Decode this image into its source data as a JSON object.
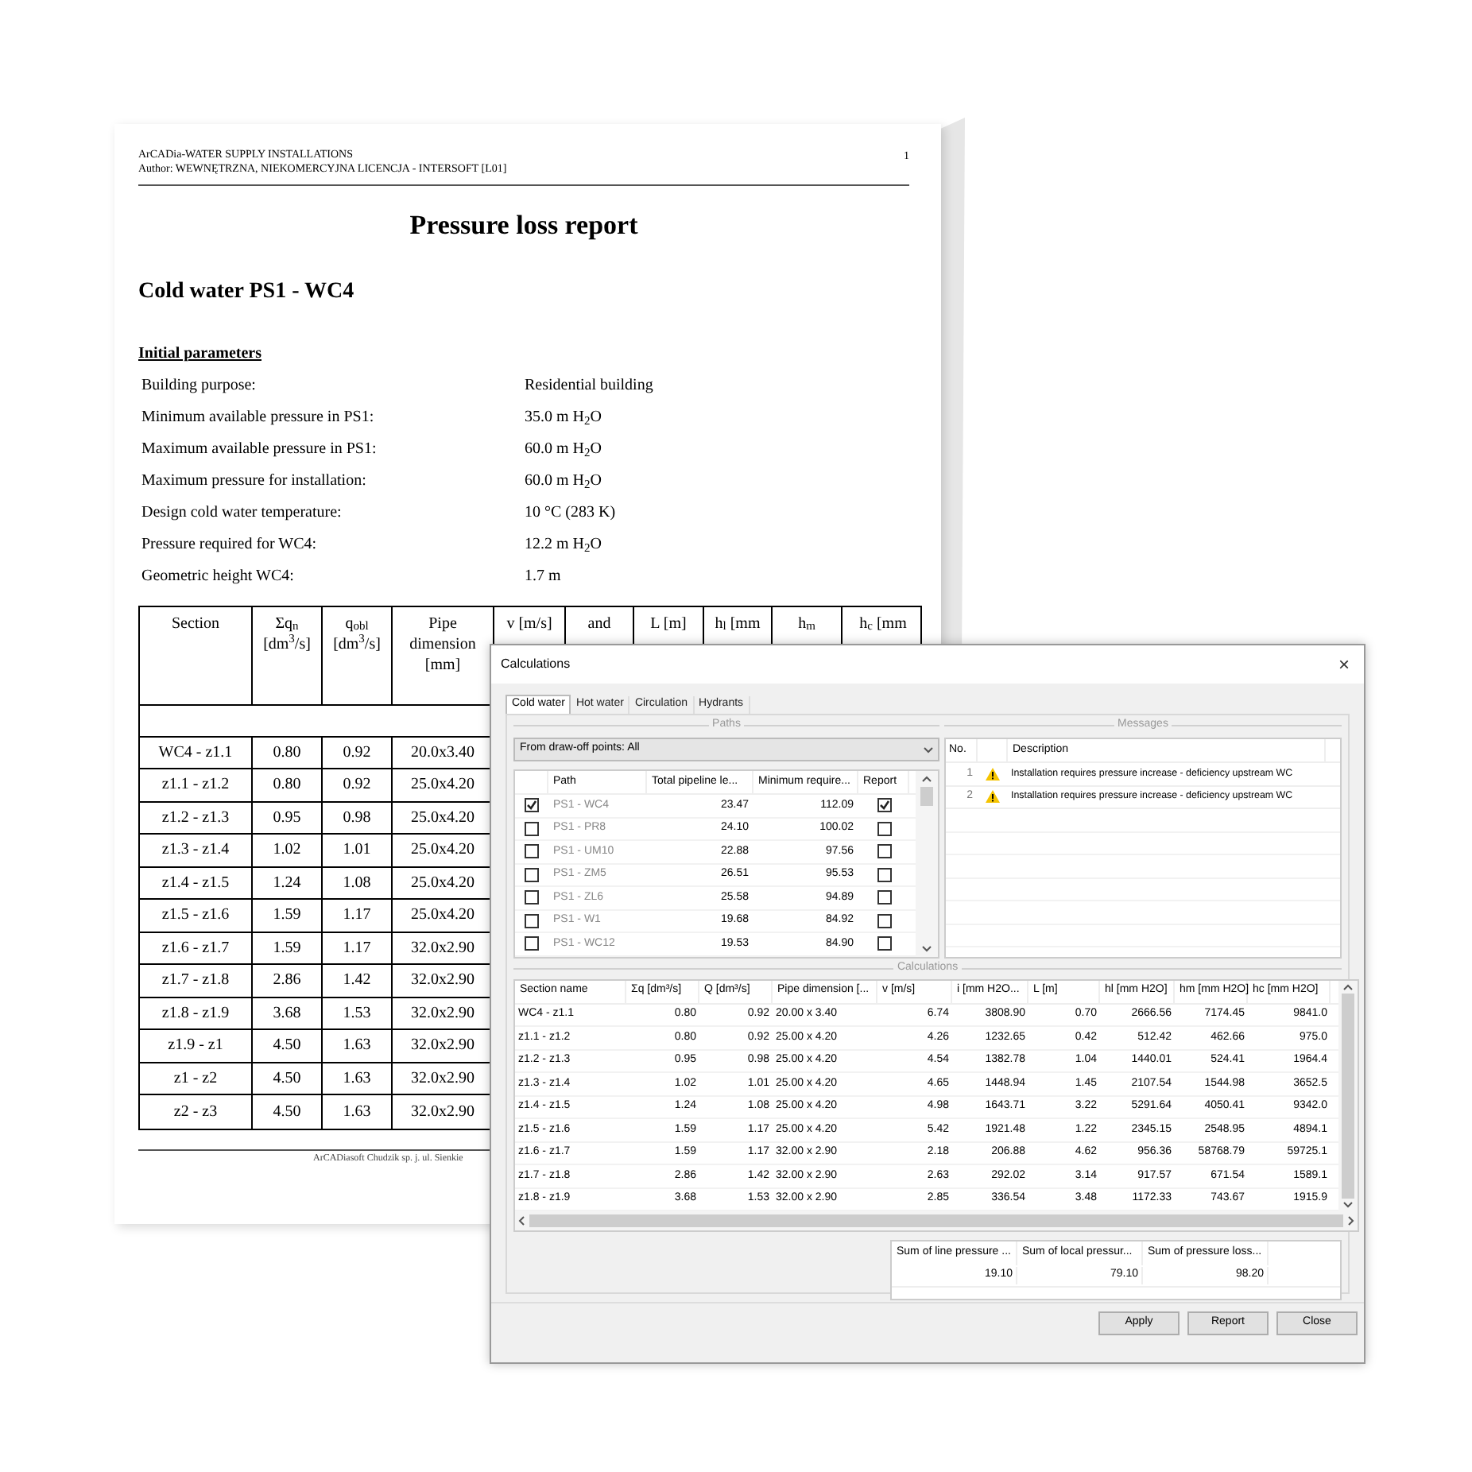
{
  "report": {
    "header_lines": [
      "ArCADia-WATER SUPPLY INSTALLATIONS",
      "Author: WEWNĘTRZNA, NIEKOMERCYJNA LICENCJA - INTERSOFT [L01]"
    ],
    "page_number": "1",
    "title": "Pressure loss report",
    "subtitle": "Cold water PS1 - WC4",
    "section_title": "Initial parameters",
    "parameters": [
      {
        "label": "Building purpose:",
        "value": "Residential building"
      },
      {
        "label": "Minimum available pressure in PS1:",
        "value": "35.0 m H$_{2}$O"
      },
      {
        "label": "Maximum available pressure in PS1:",
        "value": "60.0 m H$_{2}$O"
      },
      {
        "label": "Maximum pressure for installation:",
        "value": "60.0 m H$_{2}$O"
      },
      {
        "label": "Design cold water temperature:",
        "value": "10 °C (283 K)"
      },
      {
        "label": "Pressure required for WC4:",
        "value": "12.2 m H$_{2}$O"
      },
      {
        "label": "Geometric height WC4:",
        "value": "1.7 m"
      }
    ],
    "table": {
      "columns": [
        "Section",
        "Σq$_{n}$ [dm$^{3}$/s]",
        "q$_{obl}$ [dm$^{3}$/s]",
        "Pipe dimension [mm]",
        "v [m/s]",
        "and",
        "L [m]",
        "h$_{l}$ [mm",
        "h$_{m}$",
        "h$_{c}$ [mm"
      ],
      "rows": [
        [
          "WC4 - z1.1",
          "0.80",
          "0.92",
          "20.0x3.40"
        ],
        [
          "z1.1 - z1.2",
          "0.80",
          "0.92",
          "25.0x4.20"
        ],
        [
          "z1.2 - z1.3",
          "0.95",
          "0.98",
          "25.0x4.20"
        ],
        [
          "z1.3 - z1.4",
          "1.02",
          "1.01",
          "25.0x4.20"
        ],
        [
          "z1.4 - z1.5",
          "1.24",
          "1.08",
          "25.0x4.20"
        ],
        [
          "z1.5 - z1.6",
          "1.59",
          "1.17",
          "25.0x4.20"
        ],
        [
          "z1.6 - z1.7",
          "1.59",
          "1.17",
          "32.0x2.90"
        ],
        [
          "z1.7 - z1.8",
          "2.86",
          "1.42",
          "32.0x2.90"
        ],
        [
          "z1.8 - z1.9",
          "3.68",
          "1.53",
          "32.0x2.90"
        ],
        [
          "z1.9 - z1",
          "4.50",
          "1.63",
          "32.0x2.90"
        ],
        [
          "z1 - z2",
          "4.50",
          "1.63",
          "32.0x2.90"
        ],
        [
          "z2 - z3",
          "4.50",
          "1.63",
          "32.0x2.90"
        ]
      ]
    },
    "footer": "ArCADiasoft Chudzik sp. j. ul. Sienkie"
  },
  "dialog": {
    "title": "Calculations",
    "close": "×",
    "tabs": [
      {
        "label": "Cold water",
        "selected": true
      },
      {
        "label": "Hot water",
        "selected": false
      },
      {
        "label": "Circulation",
        "selected": false
      },
      {
        "label": "Hydrants",
        "selected": false
      }
    ],
    "paths": {
      "group_label": "Paths",
      "dropdown": "From draw-off points: All",
      "columns": [
        "Path",
        "Total pipeline le...",
        "Minimum require...",
        "Report"
      ],
      "rows": [
        {
          "checked": true,
          "path": "PS1 - WC4",
          "total": "23.47",
          "minimum": "112.09",
          "report": true
        },
        {
          "checked": false,
          "path": "PS1 - PR8",
          "total": "24.10",
          "minimum": "100.02",
          "report": false
        },
        {
          "checked": false,
          "path": "PS1 - UM10",
          "total": "22.88",
          "minimum": "97.56",
          "report": false
        },
        {
          "checked": false,
          "path": "PS1 - ZM5",
          "total": "26.51",
          "minimum": "95.53",
          "report": false
        },
        {
          "checked": false,
          "path": "PS1 - ZL6",
          "total": "25.58",
          "minimum": "94.89",
          "report": false
        },
        {
          "checked": false,
          "path": "PS1 - W1",
          "total": "19.68",
          "minimum": "84.92",
          "report": false
        },
        {
          "checked": false,
          "path": "PS1 - WC12",
          "total": "19.53",
          "minimum": "84.90",
          "report": false
        }
      ]
    },
    "messages": {
      "group_label": "Messages",
      "columns": [
        "No.",
        "Description"
      ],
      "rows": [
        {
          "no": "1",
          "description": "Installation requires pressure increase - deficiency upstream WC"
        },
        {
          "no": "2",
          "description": "Installation requires pressure increase - deficiency upstream WC"
        }
      ]
    },
    "calculations": {
      "group_label": "Calculations",
      "columns": [
        "Section name",
        "Σq [dm³/s]",
        "Q [dm³/s]",
        "Pipe dimension [...",
        "v [m/s]",
        "i [mm H2O...",
        "L [m]",
        "hl [mm H2O]",
        "hm [mm H2O]",
        "hc [mm H2O]"
      ],
      "rows": [
        [
          "WC4 - z1.1",
          "0.80",
          "0.92",
          "20.00 x 3.40",
          "6.74",
          "3808.90",
          "0.70",
          "2666.56",
          "7174.45",
          "9841.0"
        ],
        [
          "z1.1 - z1.2",
          "0.80",
          "0.92",
          "25.00 x 4.20",
          "4.26",
          "1232.65",
          "0.42",
          "512.42",
          "462.66",
          "975.0"
        ],
        [
          "z1.2 - z1.3",
          "0.95",
          "0.98",
          "25.00 x 4.20",
          "4.54",
          "1382.78",
          "1.04",
          "1440.01",
          "524.41",
          "1964.4"
        ],
        [
          "z1.3 - z1.4",
          "1.02",
          "1.01",
          "25.00 x 4.20",
          "4.65",
          "1448.94",
          "1.45",
          "2107.54",
          "1544.98",
          "3652.5"
        ],
        [
          "z1.4 - z1.5",
          "1.24",
          "1.08",
          "25.00 x 4.20",
          "4.98",
          "1643.71",
          "3.22",
          "5291.64",
          "4050.41",
          "9342.0"
        ],
        [
          "z1.5 - z1.6",
          "1.59",
          "1.17",
          "25.00 x 4.20",
          "5.42",
          "1921.48",
          "1.22",
          "2345.15",
          "2548.95",
          "4894.1"
        ],
        [
          "z1.6 - z1.7",
          "1.59",
          "1.17",
          "32.00 x 2.90",
          "2.18",
          "206.88",
          "4.62",
          "956.36",
          "58768.79",
          "59725.1"
        ],
        [
          "z1.7 - z1.8",
          "2.86",
          "1.42",
          "32.00 x 2.90",
          "2.63",
          "292.02",
          "3.14",
          "917.57",
          "671.54",
          "1589.1"
        ],
        [
          "z1.8 - z1.9",
          "3.68",
          "1.53",
          "32.00 x 2.90",
          "2.85",
          "336.54",
          "3.48",
          "1172.33",
          "743.67",
          "1915.9"
        ]
      ]
    },
    "sums": {
      "columns": [
        "Sum of line pressure ...",
        "Sum of local pressur...",
        "Sum of pressure loss..."
      ],
      "values": [
        "19.10",
        "79.10",
        "98.20"
      ]
    },
    "buttons": [
      "Apply",
      "Report",
      "Close"
    ]
  }
}
